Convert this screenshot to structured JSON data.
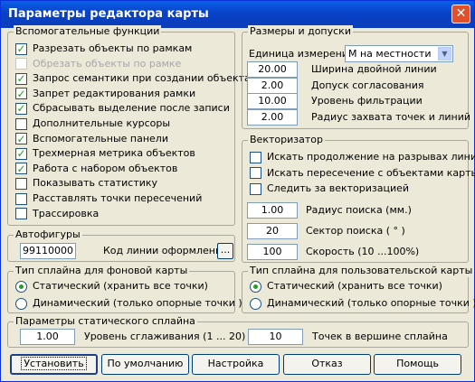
{
  "window": {
    "title": "Параметры редактора карты",
    "close_glyph": "✕"
  },
  "aux": {
    "legend": "Вспомогательные функции",
    "items": [
      {
        "label": "Разрезать объекты по рамкам",
        "checked": true,
        "enabled": true
      },
      {
        "label": "Обрезать объекты по рамке",
        "checked": false,
        "enabled": false
      },
      {
        "label": "Запрос семантики при создании объекта",
        "checked": true,
        "enabled": true
      },
      {
        "label": "Запрет редактирования рамки",
        "checked": true,
        "enabled": true
      },
      {
        "label": "Сбрасывать выделение после записи",
        "checked": true,
        "enabled": true
      },
      {
        "label": "Дополнительные курсоры",
        "checked": false,
        "enabled": true
      },
      {
        "label": "Вспомогательные панели",
        "checked": true,
        "enabled": true
      },
      {
        "label": "Трехмерная метрика объектов",
        "checked": true,
        "enabled": true
      },
      {
        "label": "Работа с набором объектов",
        "checked": true,
        "enabled": true
      },
      {
        "label": "Показывать статистику",
        "checked": false,
        "enabled": true
      },
      {
        "label": "Расставлять точки пересечений",
        "checked": false,
        "enabled": true
      },
      {
        "label": "Трассировка",
        "checked": false,
        "enabled": true
      }
    ]
  },
  "sizes": {
    "legend": "Размеры и допуски",
    "unit_label": "Единица измерения",
    "unit_value": "М на местности",
    "fields": [
      {
        "value": "20.00",
        "label": "Ширина двойной линии"
      },
      {
        "value": "2.00",
        "label": "Допуск согласования"
      },
      {
        "value": "10.00",
        "label": "Уровень фильтрации"
      },
      {
        "value": "2.00",
        "label": "Радиус захвата точек и линий"
      }
    ]
  },
  "vectorizer": {
    "legend": "Векторизатор",
    "checks": [
      {
        "label": "Искать продолжение на разрывах линий",
        "checked": false
      },
      {
        "label": "Искать пересечение с объектами карты",
        "checked": false
      },
      {
        "label": "Следить за векторизацией",
        "checked": false
      }
    ],
    "fields": [
      {
        "value": "1.00",
        "label": "Радиус поиска (мм.)"
      },
      {
        "value": "20",
        "label": "Сектор поиска ( ° )"
      },
      {
        "value": "100",
        "label": "Скорость (10 ...100%)"
      }
    ]
  },
  "autofig": {
    "legend": "Автофигуры",
    "code_value": "99110000",
    "code_label": "Код линии оформления",
    "browse_label": "..."
  },
  "bg_spline": {
    "legend": "Тип сплайна для фоновой карты",
    "options": [
      {
        "label": "Статический (хранить все точки)",
        "selected": true
      },
      {
        "label": "Динамический (только опорные точки )",
        "selected": false
      }
    ]
  },
  "user_spline": {
    "legend": "Тип сплайна для пользовательской карты",
    "options": [
      {
        "label": "Статический (хранить все точки)",
        "selected": true
      },
      {
        "label": "Динамический (только опорные точки )",
        "selected": false
      }
    ]
  },
  "static_spline": {
    "legend": "Параметры статического сплайна",
    "smoothing_value": "1.00",
    "smoothing_label": "Уровень сглаживания (1 ... 20)",
    "points_value": "10",
    "points_label": "Точек в вершине сплайна"
  },
  "buttons": {
    "set": "Установить",
    "default": "По умолчанию",
    "setup": "Настройка",
    "cancel": "Отказ",
    "help": "Помощь"
  },
  "colors": {
    "title_bar": "#0a5fe6",
    "check_mark": "#21a121",
    "dialog_bg": "#ece9d8"
  }
}
